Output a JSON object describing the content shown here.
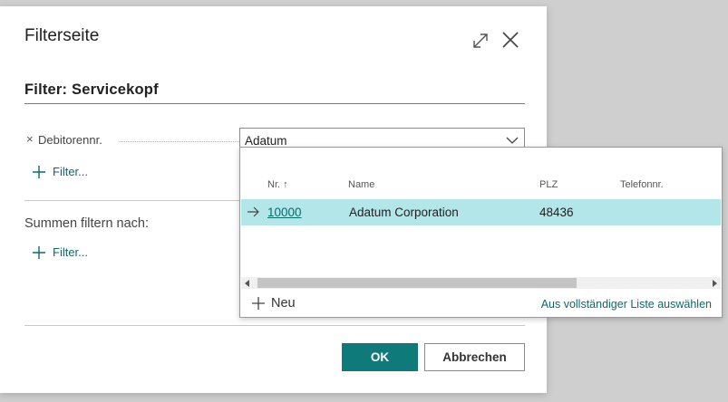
{
  "dialog": {
    "title": "Filterseite",
    "section_title": "Filter: Servicekopf",
    "filter_row": {
      "remove_glyph": "×",
      "label": "Debitorennr.",
      "value": "Adatum"
    },
    "add_filter_label": "Filter...",
    "totals_label": "Summen filtern nach:",
    "add_total_filter_label": "Filter...",
    "buttons": {
      "ok": "OK",
      "cancel": "Abbrechen"
    }
  },
  "lookup": {
    "columns": [
      "Nr. ↑",
      "Name",
      "PLZ",
      "Telefonnr."
    ],
    "rows": [
      {
        "nr": "10000",
        "name": "Adatum Corporation",
        "plz": "48436",
        "telefon": ""
      }
    ],
    "new_label": "Neu",
    "select_full_list": "Aus vollständiger Liste auswählen"
  },
  "icons": [
    "expand-icon",
    "close-icon",
    "chevron-down-icon",
    "plus-icon",
    "arrow-right-icon"
  ],
  "colors": {
    "accent": "#0f7a7a",
    "selected_row": "#b3e6e8",
    "link": "#0a6b6b"
  }
}
